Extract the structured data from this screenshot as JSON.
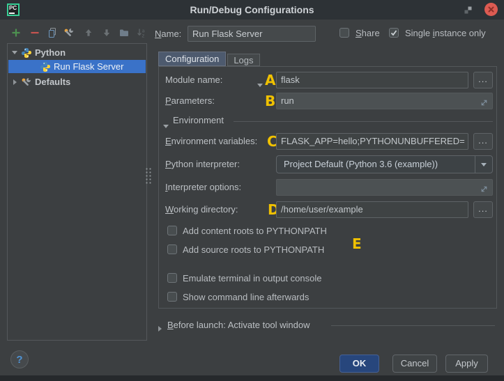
{
  "window": {
    "title": "Run/Debug Configurations",
    "logo_text": "PC"
  },
  "toolbar": {
    "icons": [
      "add",
      "remove",
      "copy",
      "edit-defaults",
      "move-up",
      "move-down",
      "new-folder",
      "sort-alphabetically"
    ]
  },
  "name_row": {
    "label": {
      "u": "N",
      "post": "ame:"
    },
    "value": "Run Flask Server",
    "share": {
      "label": {
        "u": "S",
        "post": "hare"
      },
      "checked": false
    },
    "single_instance": {
      "label": {
        "pre": "Single ",
        "u": "i",
        "post": "nstance only"
      },
      "checked": true
    }
  },
  "tree": [
    {
      "label": "Python",
      "icon": "python-icon",
      "expanded": true,
      "selected": false
    },
    {
      "label": "Run Flask Server",
      "icon": "python-icon",
      "selected": true
    },
    {
      "label": "Defaults",
      "icon": "settings-icon",
      "expanded": false,
      "selected": false
    }
  ],
  "tabs": {
    "configuration": "Configuration",
    "logs": "Logs"
  },
  "form": {
    "module_name": {
      "label": "Module name:",
      "annotation": "A",
      "value": "flask",
      "browse": "..."
    },
    "parameters": {
      "label": {
        "u": "P",
        "post": "arameters:"
      },
      "annotation": "B",
      "value": "run"
    },
    "environment_header": "Environment",
    "environment_variables": {
      "label": {
        "u": "E",
        "post": "nvironment variables:"
      },
      "annotation": "C",
      "value": "FLASK_APP=hello;PYTHONUNBUFFERED=",
      "browse": "..."
    },
    "python_interpreter": {
      "label": {
        "u": "P",
        "post": "ython interpreter:"
      },
      "value": "Project Default (Python 3.6 (example))"
    },
    "interpreter_options": {
      "label": {
        "u": "I",
        "post": "nterpreter options:"
      },
      "value": ""
    },
    "working_directory": {
      "label": {
        "u": "W",
        "post": "orking directory:"
      },
      "annotation": "D",
      "value": "/home/user/example",
      "browse": "..."
    },
    "checkboxes": [
      {
        "label": "Add content roots to PYTHONPATH",
        "checked": false
      },
      {
        "label": "Add source roots to PYTHONPATH",
        "checked": false
      },
      {
        "label": "Emulate terminal in output console",
        "checked": false
      },
      {
        "label": "Show command line afterwards",
        "checked": false
      }
    ],
    "annotation_e": "E"
  },
  "before_launch": {
    "label": {
      "u": "B",
      "post": "efore launch: Activate tool window"
    }
  },
  "buttons": {
    "ok": "OK",
    "cancel": "Cancel",
    "apply": "Apply"
  },
  "help": {
    "icon": "?"
  },
  "colors": {
    "dialog_background": "#3c3f41",
    "titlebar_background": "#2d3236",
    "selection_blue": "#3a72c8",
    "annotation_yellow": "#f0c100",
    "ok_button_blue": "#27467c",
    "close_button_red": "#dd5b52",
    "active_tab": "#4d5a6e",
    "python_blue": "#4584b6",
    "python_yellow": "#ffd43b"
  }
}
